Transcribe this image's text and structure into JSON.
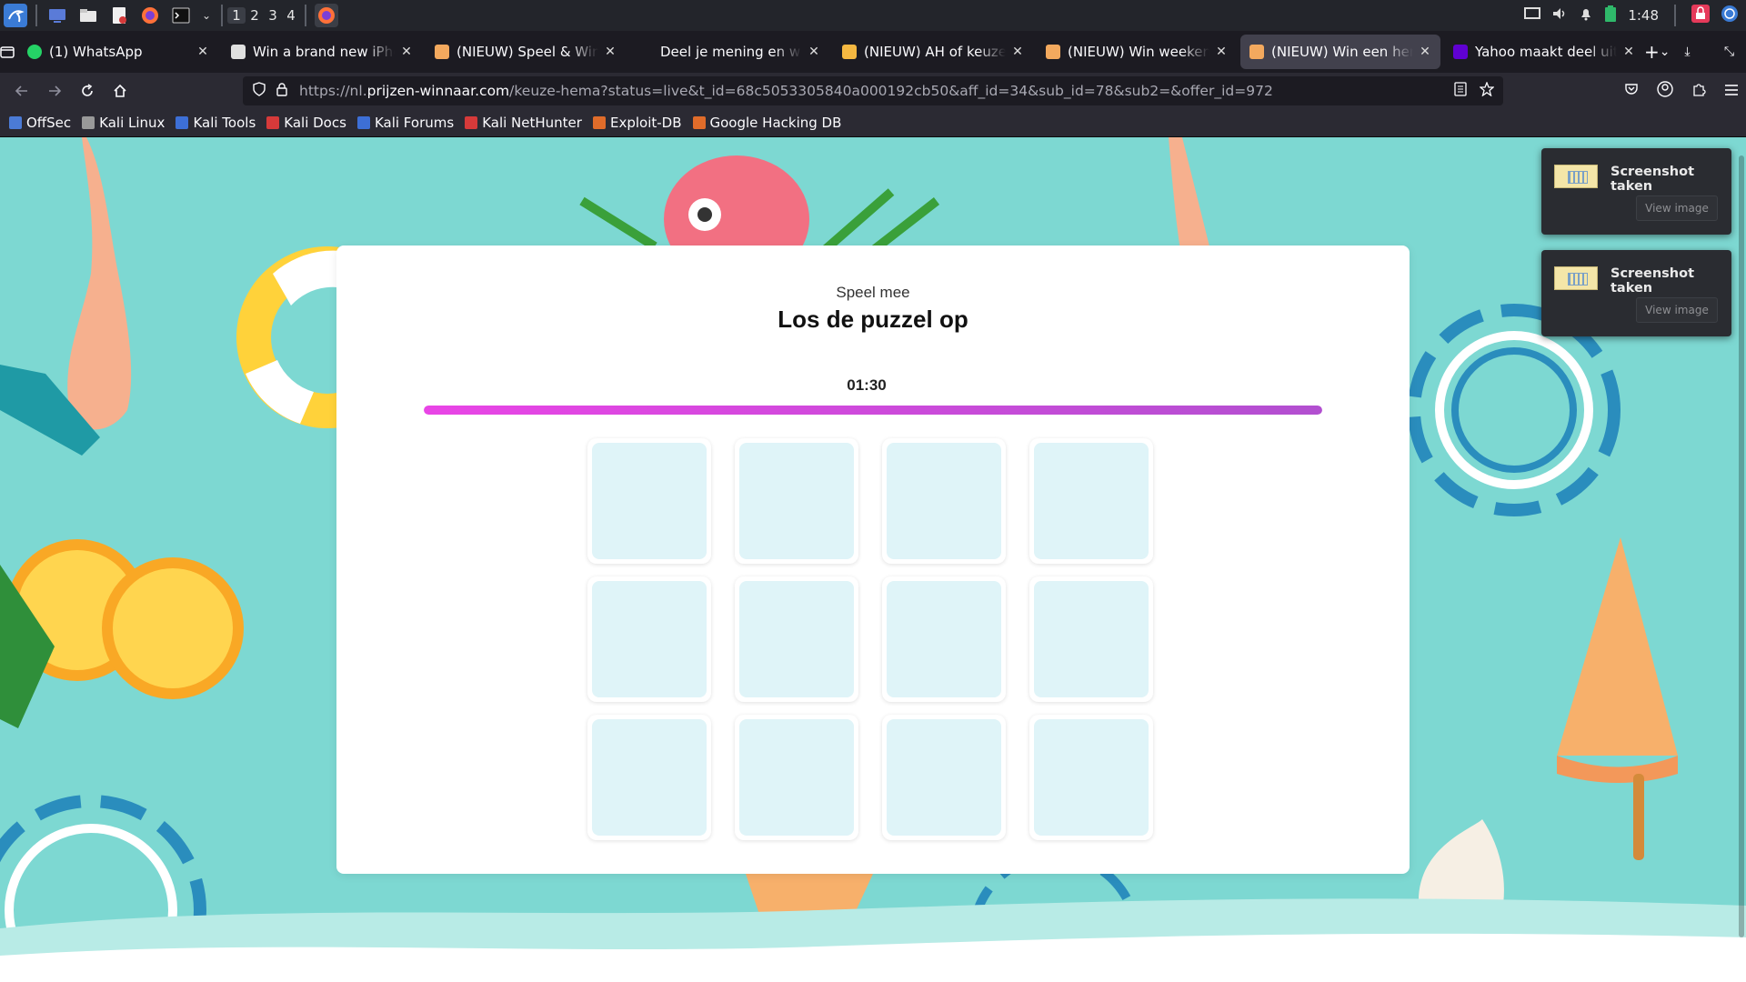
{
  "taskbar": {
    "workspaces": [
      "1",
      "2",
      "3",
      "4"
    ],
    "active_workspace": "1",
    "clock": "1:48",
    "icons": [
      "kali-menu-icon",
      "desktop-icon",
      "file-manager-icon",
      "text-editor-icon",
      "firefox-icon",
      "terminal-icon",
      "firefox-window-icon"
    ]
  },
  "tabs": [
    {
      "title": "(1) WhatsApp",
      "favicon": "whatsapp-icon",
      "color": "#25d366",
      "active": false
    },
    {
      "title": "Win a brand new iPhone",
      "favicon": "apple-icon",
      "color": "#e0e0e0",
      "active": false
    },
    {
      "title": "(NIEUW) Speel & Win Een",
      "favicon": "icecream-icon",
      "color": "#f3a95e",
      "active": false
    },
    {
      "title": "Deel je mening en win",
      "favicon": "",
      "color": "",
      "active": false
    },
    {
      "title": "(NIEUW) AH of keuze kado",
      "favicon": "smiley-icon",
      "color": "#f5b841",
      "active": false
    },
    {
      "title": "(NIEUW) Win weekendje",
      "favicon": "icecream-icon",
      "color": "#f3a95e",
      "active": false
    },
    {
      "title": "(NIEUW) Win een hema",
      "favicon": "icecream-icon",
      "color": "#f3a95e",
      "active": true
    },
    {
      "title": "Yahoo maakt deel uit van",
      "favicon": "yahoo-icon",
      "color": "#6001d2",
      "active": false
    }
  ],
  "navbar": {
    "url_prefix": "https://nl.",
    "url_domain": "prijzen-winnaar.com",
    "url_path": "/keuze-hema?status=live&t_id=68c5053305840a000192cb50&aff_id=34&sub_id=78&sub2=&offer_id=972"
  },
  "bookmarks": [
    {
      "label": "OffSec",
      "color": "#4b7bd6"
    },
    {
      "label": "Kali Linux",
      "color": "#999999"
    },
    {
      "label": "Kali Tools",
      "color": "#3d6fd6"
    },
    {
      "label": "Kali Docs",
      "color": "#d63a3a"
    },
    {
      "label": "Kali Forums",
      "color": "#3d6fd6"
    },
    {
      "label": "Kali NetHunter",
      "color": "#d63a3a"
    },
    {
      "label": "Exploit-DB",
      "color": "#e06c2a"
    },
    {
      "label": "Google Hacking DB",
      "color": "#e06c2a"
    }
  ],
  "game": {
    "kicker": "Speel mee",
    "title": "Los de puzzel op",
    "timer": "01:30",
    "progress_fraction": 1.0,
    "tile_count": 12
  },
  "notifications": [
    {
      "title": "Screenshot taken",
      "button": "View image"
    },
    {
      "title": "Screenshot taken",
      "button": "View image"
    }
  ],
  "colors": {
    "page_background": "#7dd8d2",
    "progress_start": "#e945e6",
    "progress_end": "#b24fd0",
    "tile_fill": "#dff4f8"
  }
}
